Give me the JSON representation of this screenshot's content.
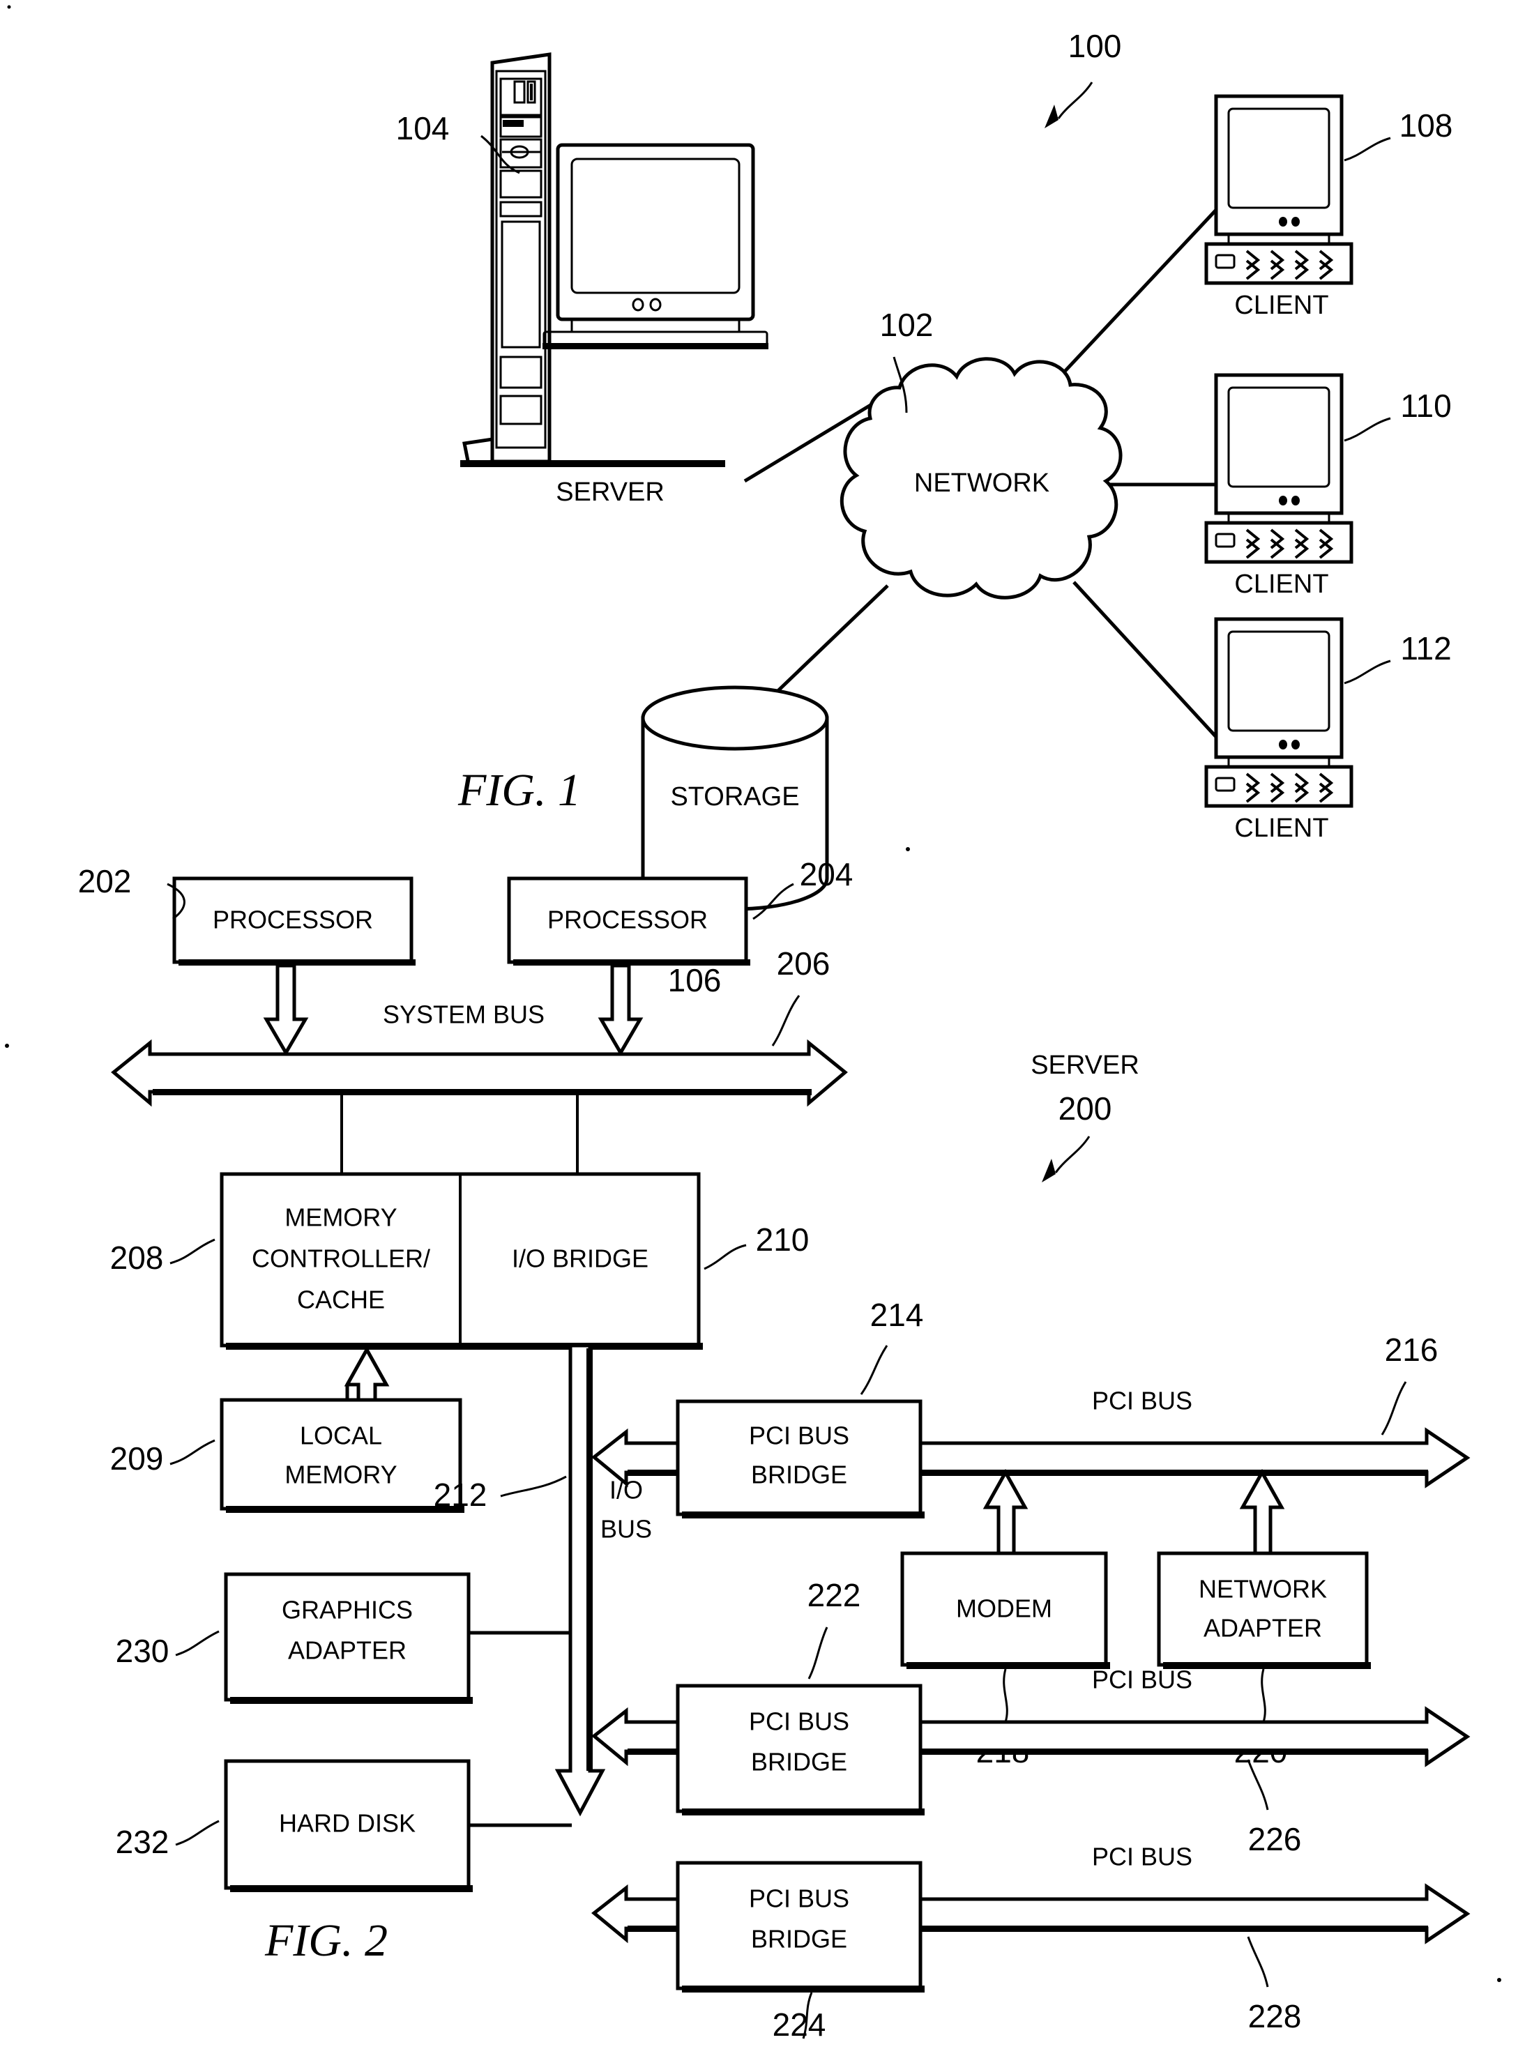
{
  "figure1": {
    "label": "FIG. 1",
    "system_ref": "100",
    "nodes": [
      {
        "id": "server",
        "caption": "SERVER",
        "ref": "104"
      },
      {
        "id": "network",
        "caption": "NETWORK",
        "ref": "102"
      },
      {
        "id": "storage",
        "caption": "STORAGE",
        "ref": "106"
      },
      {
        "id": "client1",
        "caption": "CLIENT",
        "ref": "108"
      },
      {
        "id": "client2",
        "caption": "CLIENT",
        "ref": "110"
      },
      {
        "id": "client3",
        "caption": "CLIENT",
        "ref": "112"
      }
    ]
  },
  "figure2": {
    "label": "FIG. 2",
    "title": "SERVER",
    "title_ref": "200",
    "blocks": [
      {
        "id": "processor1",
        "label": "PROCESSOR",
        "ref": "202"
      },
      {
        "id": "processor2",
        "label": "PROCESSOR",
        "ref": "204"
      },
      {
        "id": "memctl",
        "label": "MEMORY\nCONTROLLER/\nCACHE",
        "ref": "208"
      },
      {
        "id": "iobridge",
        "label": "I/O BRIDGE",
        "ref": "210"
      },
      {
        "id": "localmem",
        "label": "LOCAL\nMEMORY",
        "ref": "209"
      },
      {
        "id": "pcibridge1",
        "label": "PCI BUS\nBRIDGE",
        "ref": "214"
      },
      {
        "id": "modem",
        "label": "MODEM",
        "ref": "218"
      },
      {
        "id": "netadapter",
        "label": "NETWORK\nADAPTER",
        "ref": "220"
      },
      {
        "id": "gfxadapter",
        "label": "GRAPHICS\nADAPTER",
        "ref": "230"
      },
      {
        "id": "harddisk",
        "label": "HARD DISK",
        "ref": "232"
      },
      {
        "id": "pcibridge2",
        "label": "PCI BUS\nBRIDGE",
        "ref": "222"
      },
      {
        "id": "pcibridge3",
        "label": "PCI BUS\nBRIDGE",
        "ref": "224"
      }
    ],
    "buses": [
      {
        "id": "systembus",
        "label": "SYSTEM BUS",
        "ref": "206"
      },
      {
        "id": "iobus",
        "label": "I/O\nBUS",
        "ref": "212"
      },
      {
        "id": "pcibus1",
        "label": "PCI BUS",
        "ref": "216"
      },
      {
        "id": "pcibus2",
        "label": "PCI BUS",
        "ref": "226"
      },
      {
        "id": "pcibus3",
        "label": "PCI BUS",
        "ref": "228"
      }
    ],
    "text": {
      "processor1": "PROCESSOR",
      "processor2": "PROCESSOR",
      "memctl_line1": "MEMORY",
      "memctl_line2": "CONTROLLER/",
      "memctl_line3": "CACHE",
      "iobridge": "I/O BRIDGE",
      "localmem_line1": "LOCAL",
      "localmem_line2": "MEMORY",
      "pcibridge_line1": "PCI BUS",
      "pcibridge_line2": "BRIDGE",
      "modem": "MODEM",
      "netadapter_line1": "NETWORK",
      "netadapter_line2": "ADAPTER",
      "gfxadapter_line1": "GRAPHICS",
      "gfxadapter_line2": "ADAPTER",
      "harddisk": "HARD DISK",
      "systembus": "SYSTEM BUS",
      "iobus_line1": "I/O",
      "iobus_line2": "BUS",
      "pcibus": "PCI BUS"
    },
    "refs": {
      "r200": "200",
      "r202": "202",
      "r204": "204",
      "r206": "206",
      "r208": "208",
      "r209": "209",
      "r210": "210",
      "r212": "212",
      "r214": "214",
      "r216": "216",
      "r218": "218",
      "r220": "220",
      "r222": "222",
      "r224": "224",
      "r226": "226",
      "r228": "228",
      "r230": "230",
      "r232": "232"
    }
  },
  "colors": {
    "ink": "#000000",
    "paper": "#ffffff"
  }
}
